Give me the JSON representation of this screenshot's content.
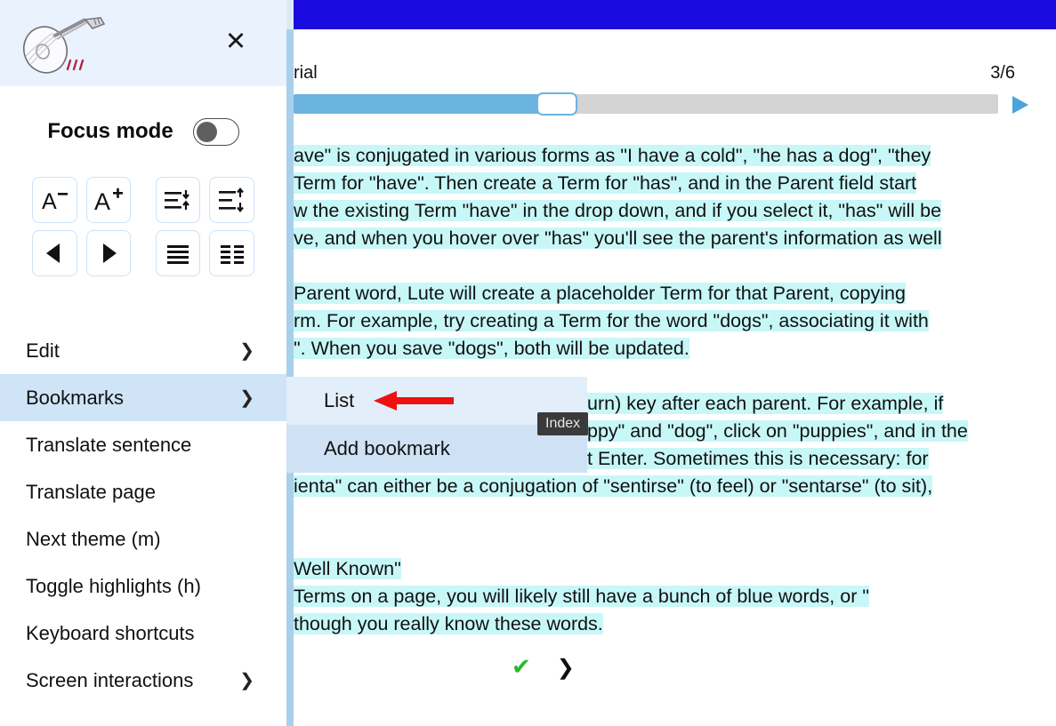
{
  "reader": {
    "top_bar_color": "#1a0ae0",
    "book_title": "rial",
    "page_counter": "3/6",
    "progress_percent": 36,
    "play_icon": "play-triangle-icon",
    "paragraphs": [
      {
        "id": "p1",
        "lines": [
          "ave\" is conjugated in various forms as \"I have a cold\", \"he has a dog\", \"they",
          "Term for \"have\". Then create a Term for \"has\", and in the Parent field start",
          "w the existing Term \"have\" in the drop down, and if you select it, \"has\" will be",
          "ve, and when you hover over \"has\" you'll see the parent's information as well"
        ]
      },
      {
        "id": "p2",
        "lines": [
          "Parent word, Lute will create a placeholder Term for that Parent, copying",
          "rm. For example, try creating a Term for the word \"dogs\", associating it with",
          "\". When you save \"dogs\", both will be updated."
        ]
      },
      {
        "id": "p3",
        "lines": [
          "urn) key after each parent. For example, if",
          "ppy\" and \"dog\", click on \"puppies\", and in the",
          "t Enter. Sometimes this is necessary: for",
          "ienta\" can either be a conjugation of \"sentirse\" (to feel) or \"sentarse\" (to sit),"
        ]
      },
      {
        "id": "p4",
        "lines": [
          "Well Known\"",
          " Terms on a page, you will likely still have a bunch of blue words, or \"",
          "though you really know these words."
        ]
      }
    ],
    "bottom_controls": {
      "check_label": "✔",
      "next_label": "❯"
    }
  },
  "sidebar": {
    "logo_name": "lute-logo",
    "close_label": "✕",
    "focus": {
      "label": "Focus mode",
      "state": "off"
    },
    "tools": [
      {
        "name": "decrease-font-size",
        "glyph": "A−"
      },
      {
        "name": "increase-font-size",
        "glyph": "A+"
      },
      {
        "name": "decrease-line-height",
        "glyph": "lines-down-up"
      },
      {
        "name": "increase-line-height",
        "glyph": "lines-up-down"
      },
      {
        "name": "previous-page",
        "glyph": "◀"
      },
      {
        "name": "next-page",
        "glyph": "▶"
      },
      {
        "name": "one-column-layout",
        "glyph": "single-column"
      },
      {
        "name": "two-column-layout",
        "glyph": "two-column"
      }
    ],
    "menu": [
      {
        "label": "Edit",
        "arrow": "❯",
        "active": false
      },
      {
        "label": "Bookmarks",
        "arrow": "❯",
        "active": true
      },
      {
        "label": "Translate sentence",
        "arrow": "",
        "active": false
      },
      {
        "label": "Translate page",
        "arrow": "",
        "active": false
      },
      {
        "label": "Next theme (m)",
        "arrow": "",
        "active": false
      },
      {
        "label": "Toggle highlights (h)",
        "arrow": "",
        "active": false
      },
      {
        "label": "Keyboard shortcuts",
        "arrow": "",
        "active": false
      },
      {
        "label": "Screen interactions",
        "arrow": "❯",
        "active": false
      }
    ]
  },
  "submenu": {
    "items": [
      {
        "label": "List",
        "style": "light"
      },
      {
        "label": "Add bookmark",
        "style": "dark"
      }
    ]
  },
  "tooltip": {
    "label": "Index"
  },
  "annotation": {
    "arrow_color": "#ee1111",
    "points_to": "List"
  },
  "colors": {
    "highlight": "#c8f7f7",
    "accent_blue": "#6cb4e0",
    "menu_active": "#cfe4f7",
    "header_bg": "#eaf3fd",
    "top_bar": "#1a0ae0"
  }
}
